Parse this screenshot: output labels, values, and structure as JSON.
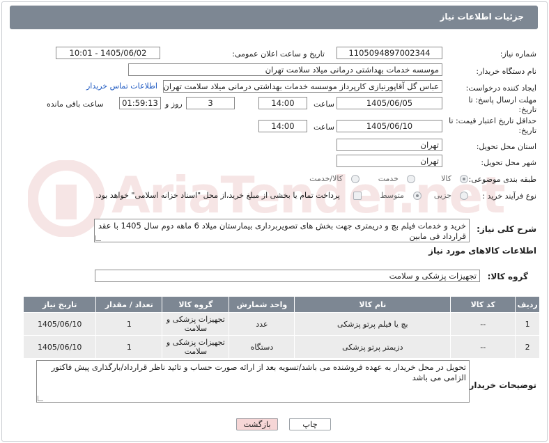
{
  "header": {
    "title": "جزئیات اطلاعات نیاز"
  },
  "form": {
    "need_number_label": "شماره نیاز:",
    "need_number": "1105094897002344",
    "announce_label": "تاریخ و ساعت اعلان عمومی:",
    "announce_value": "1405/06/02 - 10:01",
    "buyer_org_label": "نام دستگاه خریدار:",
    "buyer_org": "موسسه خدمات بهداشتی درمانی میلاد سلامت تهران",
    "creator_label": "ایجاد کننده درخواست:",
    "creator": "عباس گل آقاپورنیازی کارپرداز موسسه خدمات بهداشتی درمانی میلاد سلامت تهران",
    "contact_link": "اطلاعات تماس خریدار",
    "deadline_label": "مهلت ارسال پاسخ: تا تاریخ:",
    "deadline_date": "1405/06/05",
    "time_label": "ساعت",
    "deadline_time": "14:00",
    "days_value": "3",
    "days_label": "روز و",
    "remaining_time": "01:59:13",
    "remaining_label": "ساعت باقی مانده",
    "validity_label": "حداقل تاریخ اعتبار قیمت: تا تاریخ:",
    "validity_date": "1405/06/10",
    "validity_time": "14:00",
    "province_label": "استان محل تحویل:",
    "province": "تهران",
    "city_label": "شهر محل تحویل:",
    "city": "تهران",
    "category_label": "طبقه بندی موضوعی:",
    "category_options": [
      "کالا",
      "خدمت",
      "کالا/خدمت"
    ],
    "process_label": "نوع فرآیند خرید :",
    "process_options": [
      "جزیی",
      "متوسط"
    ],
    "payment_note": "پرداخت تمام یا بخشی از مبلغ خرید،از محل \"اسناد خزانه اسلامی\" خواهد بود."
  },
  "description": {
    "label": "شرح کلی نیاز:",
    "text": "خرید و خدمات فیلم بچ و دریمتری جهت بخش های تصویربرداری بیمارستان میلاد 6 ماهه دوم سال 1405 با عقد قرارداد فی مابین"
  },
  "goods": {
    "section_title": "اطلاعات کالاهای مورد نیاز",
    "group_label": "گروه کالا:",
    "group_value": "تجهیزات پزشکی و سلامت",
    "columns": [
      "ردیف",
      "کد کالا",
      "نام کالا",
      "واحد شمارش",
      "گروه کالا",
      "تعداد / مقدار",
      "تاریخ نیاز"
    ],
    "rows": [
      {
        "idx": "1",
        "code": "--",
        "name": "بچ یا فیلم پرتو پزشکی",
        "unit": "عدد",
        "group": "تجهیزات پزشکی و سلامت",
        "qty": "1",
        "date": "1405/06/10"
      },
      {
        "idx": "2",
        "code": "--",
        "name": "دزیمتر پرتو پزشکی",
        "unit": "دستگاه",
        "group": "تجهیزات پزشکی و سلامت",
        "qty": "1",
        "date": "1405/06/10"
      }
    ]
  },
  "buyer_notes": {
    "label": "توضیحات خریدار:",
    "text": "تحویل در محل خریدار به عهده فروشنده می باشد/تسویه بعد از ارائه صورت حساب و تائید ناظر قرارداد/بارگذاری پیش فاکتور الزامی می باشد"
  },
  "buttons": {
    "print": "چاپ",
    "back": "بازگشت"
  },
  "watermark": {
    "text": "AriaTender.net"
  },
  "colors": {
    "header": "#7d8793",
    "link": "#1a56c0",
    "back_button": "#f6d6d6",
    "print_button": "#ffffff"
  }
}
